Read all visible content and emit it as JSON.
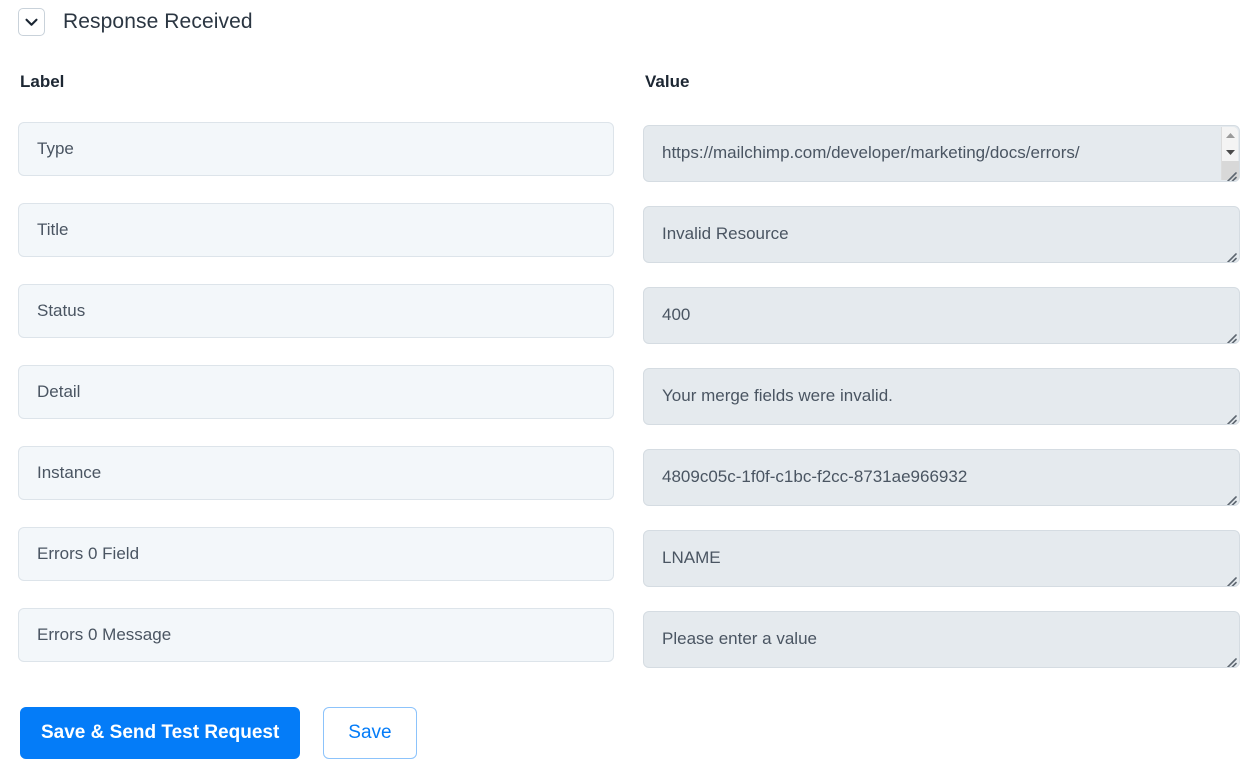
{
  "header": {
    "title": "Response Received",
    "collapse_icon": "chevron-down-icon"
  },
  "columns": {
    "label_header": "Label",
    "value_header": "Value"
  },
  "rows": [
    {
      "label": "Type",
      "value": "https://mailchimp.com/developer/marketing/docs/errors/",
      "has_scrollbar": true,
      "wrapped": true
    },
    {
      "label": "Title",
      "value": "Invalid Resource",
      "has_scrollbar": false,
      "wrapped": false
    },
    {
      "label": "Status",
      "value": "400",
      "has_scrollbar": false,
      "wrapped": false
    },
    {
      "label": "Detail",
      "value": "Your merge fields were invalid.",
      "has_scrollbar": false,
      "wrapped": false
    },
    {
      "label": "Instance",
      "value": "4809c05c-1f0f-c1bc-f2cc-8731ae966932",
      "has_scrollbar": false,
      "wrapped": false
    },
    {
      "label": "Errors 0 Field",
      "value": "LNAME",
      "has_scrollbar": false,
      "wrapped": false
    },
    {
      "label": "Errors 0 Message",
      "value": "Please enter a value",
      "has_scrollbar": false,
      "wrapped": false
    }
  ],
  "actions": {
    "primary_label": "Save & Send Test Request",
    "secondary_label": "Save"
  },
  "colors": {
    "primary_button": "#047cf8",
    "label_field_bg": "#f3f7fa",
    "value_field_bg": "#e5eaee",
    "text": "#4a5562",
    "title_text": "#2b3642"
  }
}
